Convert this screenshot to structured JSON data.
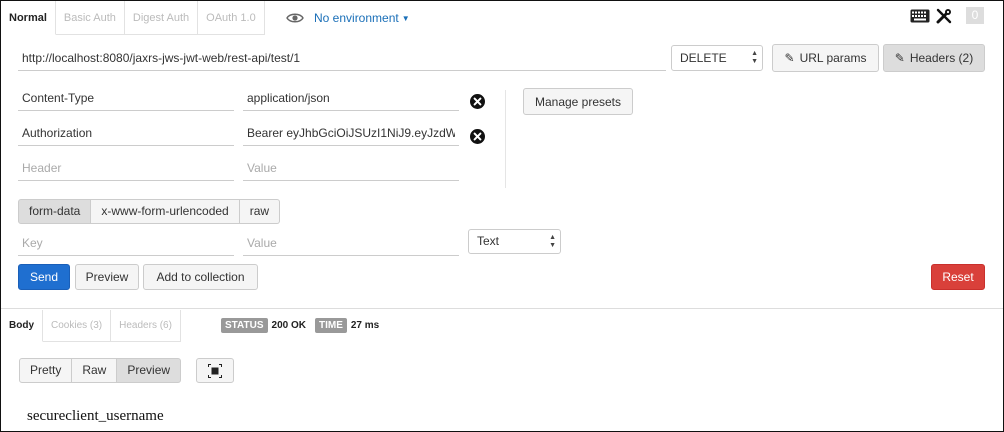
{
  "auth_tabs": [
    {
      "label": "Normal",
      "active": true
    },
    {
      "label": "Basic Auth",
      "active": false
    },
    {
      "label": "Digest Auth",
      "active": false
    },
    {
      "label": "OAuth 1.0",
      "active": false
    }
  ],
  "environment": {
    "label": "No environment",
    "icon": "eye-icon"
  },
  "top_right": {
    "keyboard_icon": "keyboard-icon",
    "tools_icon": "tools-icon",
    "count": "0"
  },
  "request": {
    "url": "http://localhost:8080/jaxrs-jws-jwt-web/rest-api/test/1",
    "method": "DELETE",
    "url_params_label": "URL params",
    "headers_label": "Headers (2)"
  },
  "headers": [
    {
      "key": "Content-Type",
      "value": "application/json"
    },
    {
      "key": "Authorization",
      "value": "Bearer eyJhbGciOiJSUzI1NiJ9.eyJzdW"
    }
  ],
  "header_placeholders": {
    "key": "Header",
    "value": "Value"
  },
  "manage_presets_label": "Manage presets",
  "body_modes": [
    {
      "label": "form-data",
      "active": true
    },
    {
      "label": "x-www-form-urlencoded",
      "active": false
    },
    {
      "label": "raw",
      "active": false
    }
  ],
  "form_placeholders": {
    "key": "Key",
    "value": "Value"
  },
  "form_type": "Text",
  "actions": {
    "send": "Send",
    "preview": "Preview",
    "add_to_collection": "Add to collection",
    "reset": "Reset"
  },
  "colors": {
    "send": "#1f6fd0",
    "reset": "#d9403a",
    "link": "#1a6fb8"
  },
  "response_tabs": [
    {
      "label": "Body",
      "active": true
    },
    {
      "label": "Cookies (3)",
      "active": false
    },
    {
      "label": "Headers (6)",
      "active": false
    }
  ],
  "status": {
    "status_tag": "STATUS",
    "status_value": "200 OK",
    "time_tag": "TIME",
    "time_value": "27 ms"
  },
  "view_modes": [
    {
      "label": "Pretty",
      "active": false
    },
    {
      "label": "Raw",
      "active": false
    },
    {
      "label": "Preview",
      "active": true
    }
  ],
  "response_body": "secureclient_username"
}
